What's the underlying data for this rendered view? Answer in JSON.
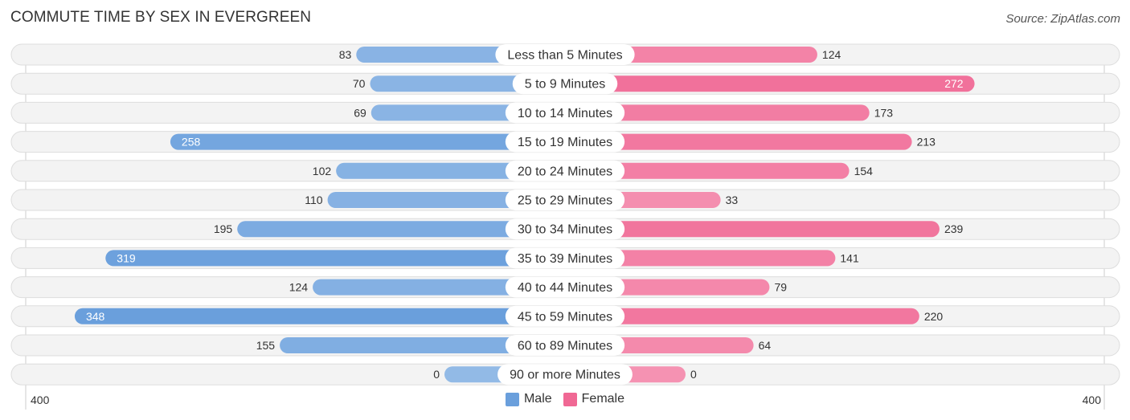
{
  "title": "COMMUTE TIME BY SEX IN EVERGREEN",
  "source": "Source: ZipAtlas.com",
  "colors": {
    "male": "#6a9fdc",
    "male_light": "#a8c8ec",
    "female": "#f06894",
    "female_light": "#f7a8c2"
  },
  "chart_data": {
    "type": "bar",
    "orientation": "horizontal-diverging",
    "title": "COMMUTE TIME BY SEX IN EVERGREEN",
    "categories": [
      "Less than 5 Minutes",
      "5 to 9 Minutes",
      "10 to 14 Minutes",
      "15 to 19 Minutes",
      "20 to 24 Minutes",
      "25 to 29 Minutes",
      "30 to 34 Minutes",
      "35 to 39 Minutes",
      "40 to 44 Minutes",
      "45 to 59 Minutes",
      "60 to 89 Minutes",
      "90 or more Minutes"
    ],
    "series": [
      {
        "name": "Male",
        "values": [
          83,
          70,
          69,
          258,
          102,
          110,
          195,
          319,
          124,
          348,
          155,
          0
        ]
      },
      {
        "name": "Female",
        "values": [
          124,
          272,
          173,
          213,
          154,
          33,
          239,
          141,
          79,
          220,
          64,
          0
        ]
      }
    ],
    "xlim": [
      -400,
      400
    ],
    "axis_labels": {
      "left": "400",
      "right": "400"
    },
    "legend": {
      "position": "bottom-center",
      "entries": [
        "Male",
        "Female"
      ]
    },
    "grid": false
  }
}
